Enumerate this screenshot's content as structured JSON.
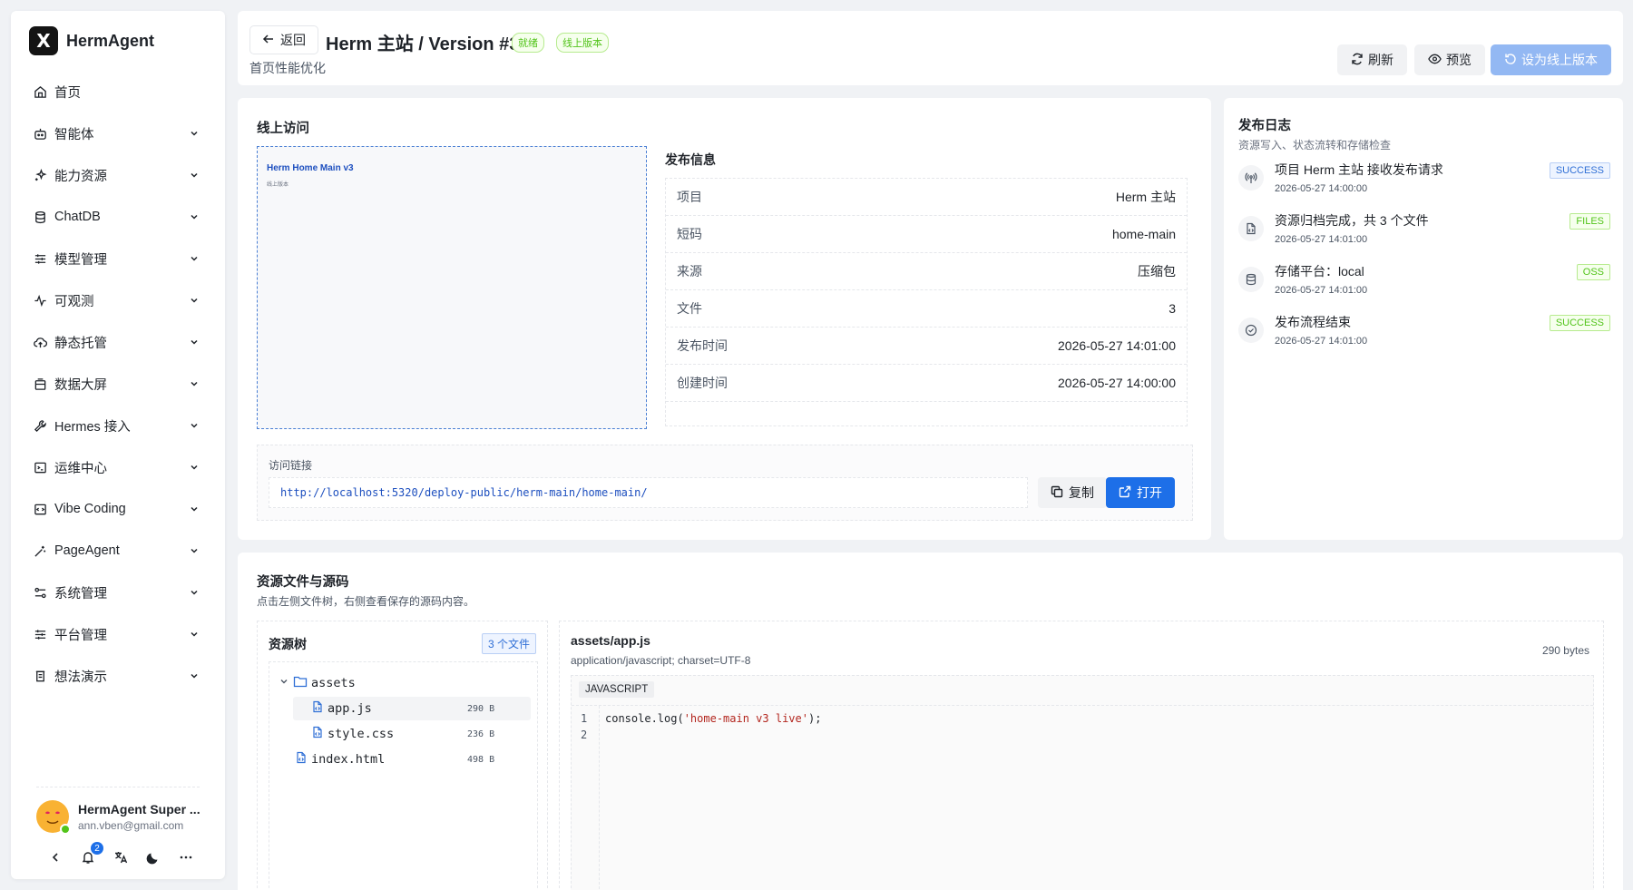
{
  "brand": {
    "logo_letter": "X",
    "name": "HermAgent"
  },
  "sidebar": {
    "items": [
      {
        "label": "首页",
        "icon": "home-icon",
        "expandable": false
      },
      {
        "label": "智能体",
        "icon": "bot-icon",
        "expandable": true
      },
      {
        "label": "能力资源",
        "icon": "sparkles-icon",
        "expandable": true
      },
      {
        "label": "ChatDB",
        "icon": "database-icon",
        "expandable": true
      },
      {
        "label": "模型管理",
        "icon": "sliders-icon",
        "expandable": true
      },
      {
        "label": "可观测",
        "icon": "activity-icon",
        "expandable": true
      },
      {
        "label": "静态托管",
        "icon": "cloud-upload-icon",
        "expandable": true
      },
      {
        "label": "数据大屏",
        "icon": "monitor-icon",
        "expandable": true
      },
      {
        "label": "Hermes 接入",
        "icon": "wrench-icon",
        "expandable": true
      },
      {
        "label": "运维中心",
        "icon": "terminal-icon",
        "expandable": true
      },
      {
        "label": "Vibe Coding",
        "icon": "code-icon",
        "expandable": true
      },
      {
        "label": "PageAgent",
        "icon": "wand-icon",
        "expandable": true
      },
      {
        "label": "系统管理",
        "icon": "settings-icon",
        "expandable": true
      },
      {
        "label": "平台管理",
        "icon": "sliders-icon",
        "expandable": true
      },
      {
        "label": "想法演示",
        "icon": "presentation-icon",
        "expandable": true
      }
    ],
    "user": {
      "name": "HermAgent Super ...",
      "email": "ann.vben@gmail.com"
    },
    "notifications_count": "2"
  },
  "header": {
    "back_label": "返回",
    "title": "Herm 主站 / Version #3",
    "status_tag": "就绪",
    "live_tag": "线上版本",
    "subtitle": "首页性能优化",
    "refresh_label": "刷新",
    "preview_label": "预览",
    "set_live_label": "设为线上版本"
  },
  "online": {
    "title": "线上访问",
    "preview_title": "Herm Home Main v3",
    "preview_sub": "线上版本",
    "publish_info_title": "发布信息",
    "info": [
      {
        "key": "项目",
        "value": "Herm 主站"
      },
      {
        "key": "短码",
        "value": "home-main"
      },
      {
        "key": "来源",
        "value": "压缩包"
      },
      {
        "key": "文件",
        "value": "3"
      },
      {
        "key": "发布时间",
        "value": "2026-05-27 14:01:00"
      },
      {
        "key": "创建时间",
        "value": "2026-05-27 14:00:00"
      }
    ],
    "link_label": "访问链接",
    "link_url": "http://localhost:5320/deploy-public/herm-main/home-main/",
    "copy_label": "复制",
    "open_label": "打开"
  },
  "log": {
    "title": "发布日志",
    "subtitle": "资源写入、状态流转和存储检查",
    "entries": [
      {
        "text": "项目 Herm 主站 接收发布请求",
        "time": "2026-05-27 14:00:00",
        "tag": "SUCCESS",
        "icon": "broadcast-icon"
      },
      {
        "text": "资源归档完成，共 3 个文件",
        "time": "2026-05-27 14:01:00",
        "tag": "FILES",
        "icon": "file-code-icon"
      },
      {
        "text": "存储平台：local",
        "time": "2026-05-27 14:01:00",
        "tag": "OSS",
        "icon": "database-icon"
      },
      {
        "text": "发布流程结束",
        "time": "2026-05-27 14:01:00",
        "tag": "SUCCESS",
        "icon": "check-circle-icon"
      }
    ]
  },
  "resources": {
    "title": "资源文件与源码",
    "subtitle": "点击左侧文件树，右侧查看保存的源码内容。",
    "tree_title": "资源树",
    "file_count": "3 个文件",
    "tree": [
      {
        "name": "assets",
        "type": "folder",
        "size": ""
      },
      {
        "name": "app.js",
        "type": "file",
        "size": "290 B"
      },
      {
        "name": "style.css",
        "type": "file",
        "size": "236 B"
      },
      {
        "name": "index.html",
        "type": "file",
        "size": "498 B"
      }
    ],
    "code": {
      "file_name": "assets/app.js",
      "mime": "application/javascript; charset=UTF-8",
      "size": "290 bytes",
      "language": "JAVASCRIPT",
      "line_numbers": [
        "1",
        "2"
      ],
      "code_prefix": "console.log(",
      "code_string": "'home-main v3 live'",
      "code_suffix": ");"
    }
  }
}
